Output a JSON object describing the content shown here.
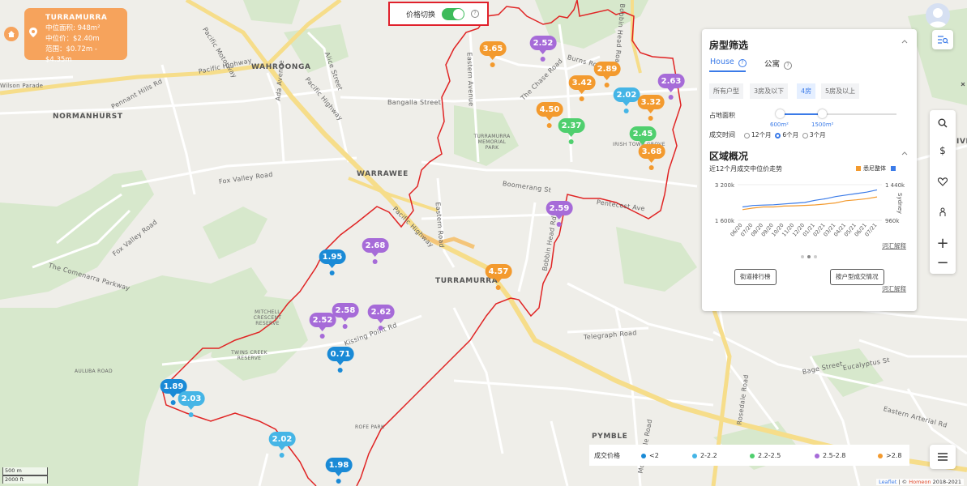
{
  "info_card": {
    "suburb": "TURRAMURRA",
    "median_area": "中位面积: 948m²",
    "median_price": "中位价：$2.40m",
    "range": "范围：$0.72m - $4.35m"
  },
  "price_toggle": {
    "label": "价格切换",
    "on": true,
    "help": "?"
  },
  "place_labels": {
    "wahroonga": "WAHROONGA",
    "normanhurst": "NORMANHURST",
    "warrawee": "WARRAWEE",
    "turramurra": "TURRAMURRA",
    "pymble": "PYMBLE",
    "pennant_hills_rd": "Pennant Hills Rd",
    "pacific_hwy_1": "Pacific Highway",
    "pacific_hwy_2": "Pacific Highway",
    "pacific_hwy_3": "Pacific Highway",
    "pacific_mwy": "Pacific Motorway",
    "fox_valley_rd_1": "Fox Valley Road",
    "fox_valley_rd_2": "Fox Valley Road",
    "comenarra": "The Comenarra Parkway",
    "burns_rd": "Burns Road",
    "bangalla": "Bangalla Street",
    "boomerang": "Boomerang St",
    "eastern_rd": "Eastern Road",
    "bobbin_head_1": "Bobbin Head Road",
    "bobbin_head_2": "Bobbin Head Rd",
    "telegraph": "Telegraph Road",
    "mona_vale": "Mona Vale Road",
    "eastern_arterial": "Eastern Arterial Rd",
    "kissing_point": "Kissing Point Rd",
    "turramurra_park": "TURRAMURRA MEMORIAL PARK",
    "mitchell_reserve": "MITCHELL CRESCENT RESERVE",
    "twins_creek": "TWINS CREEK RESERVE",
    "auluba": "AULUBA ROAD",
    "rofe_park": "ROFE PARK",
    "irish_grove": "IRISH TOWN GROVE",
    "wilson_parade": "Wilson Parade",
    "the_chase": "The Chase Road",
    "eastern_ave": "Eastern Avenue",
    "alice_st": "Alice Street",
    "ada_ave": "Ada Avenue",
    "rosedale_rd": "Rosedale Road",
    "bage_st": "Bage Street",
    "eucalyptus": "Eucalyptus St",
    "pentecost": "Pentecost Ave",
    "lives": "IVES"
  },
  "markers": [
    {
      "value": "3.65",
      "color": "#f39a2e",
      "label_visible": true
    },
    {
      "value": "2.52",
      "color": "#a66bd8"
    },
    {
      "value": "2.89",
      "color": "#f39a2e"
    },
    {
      "value": "3.42",
      "color": "#f39a2e"
    },
    {
      "value": "2.63",
      "color": "#a66bd8"
    },
    {
      "value": "2.02",
      "color": "#45b5e6"
    },
    {
      "value": "3.32",
      "color": "#f39a2e"
    },
    {
      "value": "4.50",
      "color": "#f39a2e"
    },
    {
      "value": "2.37",
      "color": "#4fcf6e"
    },
    {
      "value": "2.45",
      "color": "#4fcf6e"
    },
    {
      "value": "3.68",
      "color": "#f39a2e"
    },
    {
      "value": "2.59",
      "color": "#a66bd8"
    },
    {
      "value": "2.68",
      "color": "#a66bd8"
    },
    {
      "value": "1.95",
      "color": "#1a8ad6"
    },
    {
      "value": "4.57",
      "color": "#f39a2e"
    },
    {
      "value": "2.58",
      "color": "#a66bd8"
    },
    {
      "value": "2.52",
      "color": "#a66bd8"
    },
    {
      "value": "2.62",
      "color": "#a66bd8"
    },
    {
      "value": "0.71",
      "color": "#1a8ad6"
    },
    {
      "value": "1.89",
      "color": "#1a8ad6"
    },
    {
      "value": "2.03",
      "color": "#45b5e6"
    },
    {
      "value": "2.02",
      "color": "#45b5e6"
    },
    {
      "value": "1.98",
      "color": "#1a8ad6"
    }
  ],
  "filter_panel": {
    "title": "房型筛选",
    "tab_house": "House",
    "tab_unit": "公寓",
    "help": "?",
    "chips": [
      "所有户型",
      "3房及以下",
      "4房",
      "5房及以上"
    ],
    "active_chip": "4房",
    "land_area_label": "占地面积",
    "slider_min": "600m²",
    "slider_max": "1500m²",
    "period_label": "成交时间",
    "periods": [
      "12个月",
      "6个月",
      "3个月"
    ],
    "selected_period": "6个月",
    "region_title": "区域概况",
    "chart_caption": "近12个月成交中位价走势",
    "legend_suburb": "悉尼整体",
    "chart_side_label": "Sydney",
    "glossary": "词汇解释",
    "btn_street": "街道排行榜",
    "btn_type": "按户型成交情况",
    "glossary2": "词汇解释"
  },
  "chart_data": {
    "type": "line",
    "title": "近12个月成交中位价走势",
    "x": [
      "06/20",
      "07/20",
      "08/20",
      "09/20",
      "10/20",
      "11/20",
      "12/20",
      "01/21",
      "02/21",
      "03/21",
      "04/21",
      "05/21",
      "06/21",
      "07/21"
    ],
    "left_axis_ticks": [
      "3 200k",
      "1 600k"
    ],
    "right_axis_ticks": [
      "1 440k",
      "960k"
    ],
    "left_ylim": [
      1600000,
      3200000
    ],
    "right_ylim": [
      960000,
      1440000
    ],
    "series": [
      {
        "name": "",
        "color": "#f39a2e",
        "axis": "left",
        "values": [
          2080000,
          2150000,
          2200000,
          2200000,
          2240000,
          2250000,
          2270000,
          2290000,
          2330000,
          2380000,
          2480000,
          2520000,
          2570000,
          2650000
        ]
      },
      {
        "name": "悉尼整体",
        "color": "#3b7be8",
        "axis": "right",
        "values": [
          1140000,
          1160000,
          1165000,
          1170000,
          1180000,
          1190000,
          1200000,
          1230000,
          1250000,
          1280000,
          1300000,
          1320000,
          1340000,
          1370000
        ]
      }
    ]
  },
  "legend": {
    "title": "成交价格",
    "items": [
      {
        "label": "<2",
        "color": "#1a8ad6"
      },
      {
        "label": "2-2.2",
        "color": "#45b5e6"
      },
      {
        "label": "2.2-2.5",
        "color": "#4fcf6e"
      },
      {
        "label": "2.5-2.8",
        "color": "#a66bd8"
      },
      {
        "label": ">2.8",
        "color": "#f39a2e"
      }
    ]
  },
  "scale": {
    "metric": "500 m",
    "imperial": "2000 ft"
  },
  "attribution": {
    "leaflet": "Leaflet",
    "sep": " | © ",
    "homeon": "Homeon",
    "years": " 2018-2021"
  }
}
